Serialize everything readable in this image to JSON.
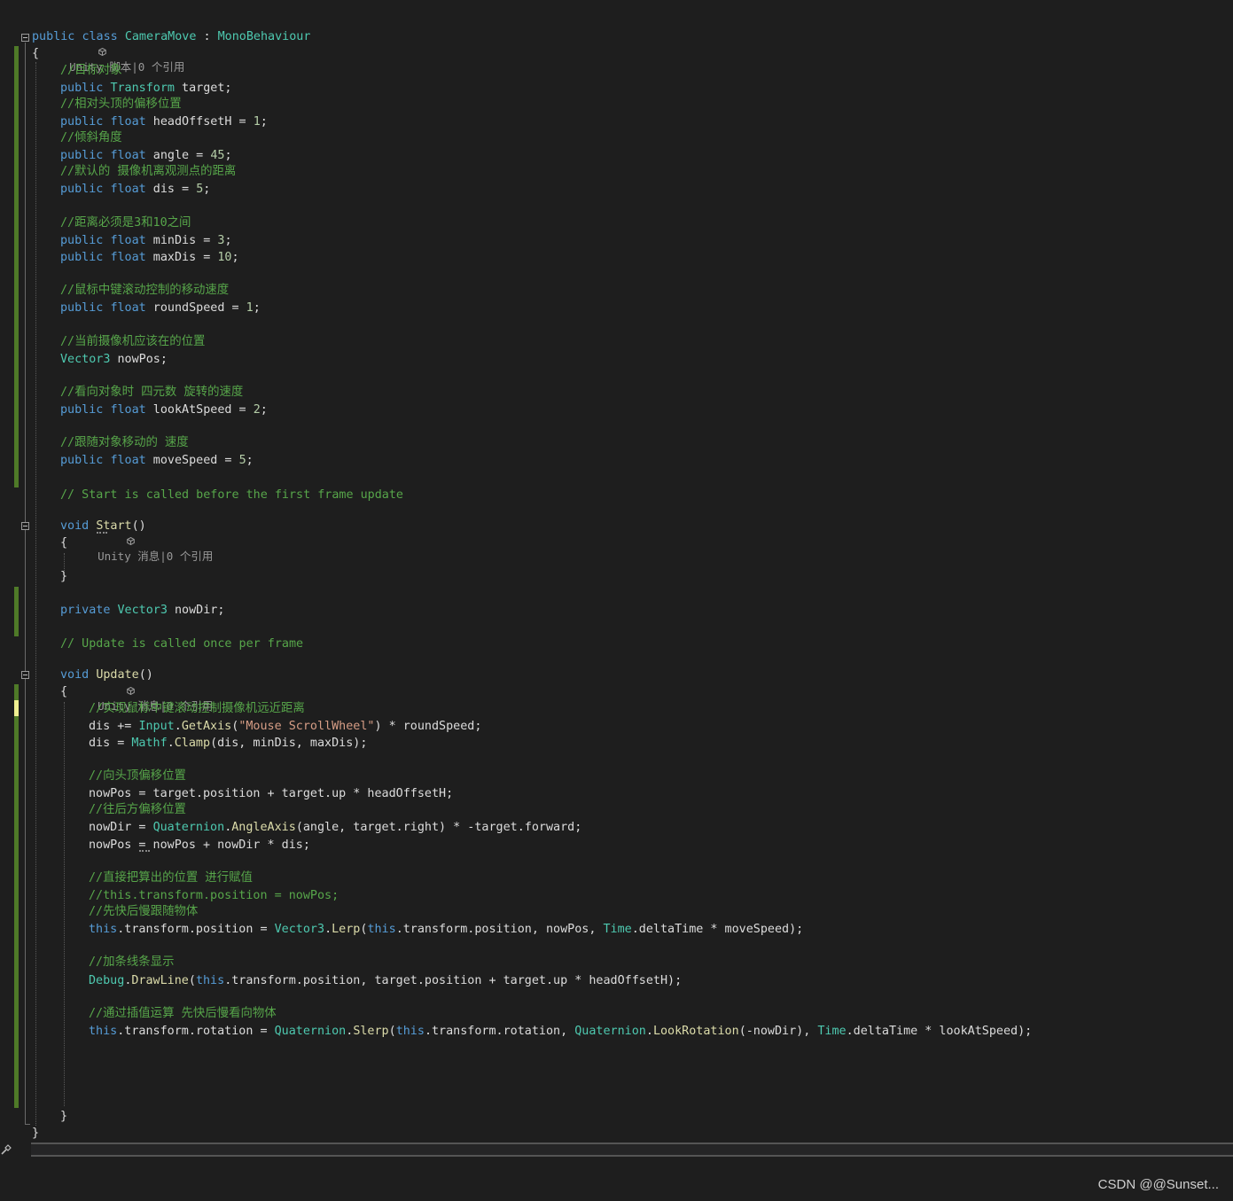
{
  "colors": {
    "background": "#1e1e1e",
    "keyword": "#569cd6",
    "type": "#4ec9b0",
    "comment": "#57a64a",
    "string": "#d69d85",
    "method": "#dcdcaa",
    "number": "#b5cea8",
    "text": "#dcdcdc",
    "change_saved": "#4f7a28",
    "change_unsaved": "#efef91"
  },
  "code": {
    "codelens_class": "Unity 脚本|0 个引用",
    "codelens_start": "Unity 消息|0 个引用",
    "codelens_update": "Unity 消息|0 个引用",
    "lines": {
      "l01": [
        "public",
        " ",
        "class",
        " ",
        "CameraMove",
        " : ",
        "MonoBehaviour"
      ],
      "l02": [
        "{"
      ],
      "l03": [
        "//目标对象"
      ],
      "l04": [
        "public",
        " ",
        "Transform",
        " target;"
      ],
      "l05": [
        "//相对头顶的偏移位置"
      ],
      "l06": [
        "public",
        " ",
        "float",
        " headOffsetH = ",
        "1",
        ";"
      ],
      "l07": [
        "//倾斜角度"
      ],
      "l08": [
        "public",
        " ",
        "float",
        " angle = ",
        "45",
        ";"
      ],
      "l09": [
        "//默认的 摄像机离观测点的距离"
      ],
      "l10": [
        "public",
        " ",
        "float",
        " dis = ",
        "5",
        ";"
      ],
      "l11": [
        "//距离必须是3和10之间"
      ],
      "l12": [
        "public",
        " ",
        "float",
        " minDis = ",
        "3",
        ";"
      ],
      "l13": [
        "public",
        " ",
        "float",
        " maxDis = ",
        "10",
        ";"
      ],
      "l14": [
        "//鼠标中键滚动控制的移动速度"
      ],
      "l15": [
        "public",
        " ",
        "float",
        " roundSpeed = ",
        "1",
        ";"
      ],
      "l16": [
        "//当前摄像机应该在的位置"
      ],
      "l17": [
        "Vector3",
        " nowPos;"
      ],
      "l18": [
        "//看向对象时 四元数 旋转的速度"
      ],
      "l19": [
        "public",
        " ",
        "float",
        " lookAtSpeed = ",
        "2",
        ";"
      ],
      "l20": [
        "//跟随对象移动的 速度"
      ],
      "l21": [
        "public",
        " ",
        "float",
        " moveSpeed = ",
        "5",
        ";"
      ],
      "l22": [
        "// Start is called before the first frame update"
      ],
      "l23": [
        "void",
        " ",
        "Start",
        "()"
      ],
      "l24": [
        "{"
      ],
      "l25": [
        "}"
      ],
      "l26": [
        "private",
        " ",
        "Vector3",
        " nowDir;"
      ],
      "l27": [
        "// Update is called once per frame"
      ],
      "l28": [
        "void",
        " ",
        "Update",
        "()"
      ],
      "l29": [
        "{"
      ],
      "l30": [
        "//实现鼠标中键滚动控制摄像机远近距离"
      ],
      "l31": [
        "dis += ",
        "Input",
        ".",
        "GetAxis",
        "(",
        "\"Mouse ScrollWheel\"",
        ") * roundSpeed;"
      ],
      "l32": [
        "dis = ",
        "Mathf",
        ".",
        "Clamp",
        "(dis, minDis, maxDis);"
      ],
      "l33": [
        "//向头顶偏移位置"
      ],
      "l34": [
        "nowPos = target.position + target.up * headOffsetH;"
      ],
      "l35": [
        "//往后方偏移位置"
      ],
      "l36": [
        "nowDir = ",
        "Quaternion",
        ".",
        "AngleAxis",
        "(angle, target.right) * -target.forward;"
      ],
      "l37": [
        "nowPos = nowPos + nowDir * dis;"
      ],
      "l38": [
        "//直接把算出的位置 进行赋值"
      ],
      "l39": [
        "//this.transform.position = nowPos;"
      ],
      "l40": [
        "//先快后慢跟随物体"
      ],
      "l41": [
        "this",
        ".transform.position = ",
        "Vector3",
        ".",
        "Lerp",
        "(",
        "this",
        ".transform.position, nowPos, ",
        "Time",
        ".deltaTime * moveSpeed);"
      ],
      "l42": [
        "//加条线条显示"
      ],
      "l43": [
        "Debug",
        ".",
        "DrawLine",
        "(",
        "this",
        ".transform.position, target.position + target.up * headOffsetH);"
      ],
      "l44": [
        "//通过插值运算 先快后慢看向物体"
      ],
      "l45": [
        "this",
        ".transform.rotation = ",
        "Quaternion",
        ".",
        "Slerp",
        "(",
        "this",
        ".transform.rotation, ",
        "Quaternion",
        ".",
        "LookRotation",
        "(-nowDir), ",
        "Time",
        ".deltaTime * lookAtSpeed);"
      ],
      "l46": [
        "}"
      ],
      "l47": [
        "}"
      ]
    }
  },
  "icons": {
    "codelens": "unity-cube-icon",
    "fold": "collapse-box-icon",
    "brush": "format-brush-icon"
  },
  "watermark": "CSDN @@Sunset..."
}
